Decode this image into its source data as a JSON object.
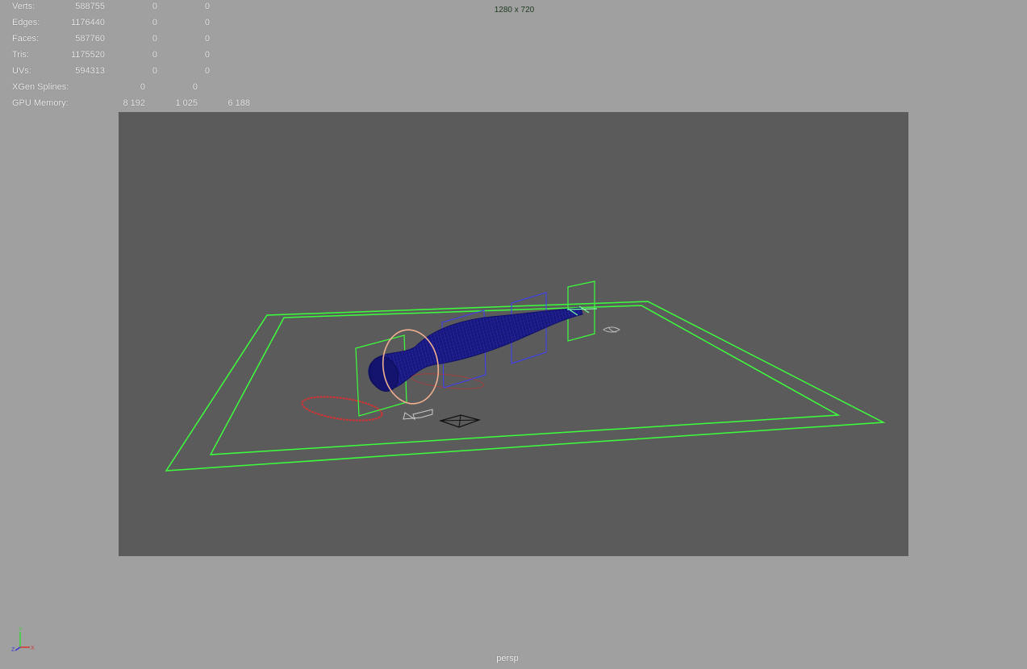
{
  "hud": {
    "verts": {
      "label": "Verts:",
      "values": [
        "588755",
        "0",
        "0"
      ]
    },
    "edges": {
      "label": "Edges:",
      "values": [
        "1176440",
        "0",
        "0"
      ]
    },
    "faces": {
      "label": "Faces:",
      "values": [
        "587760",
        "0",
        "0"
      ]
    },
    "tris": {
      "label": "Tris:",
      "values": [
        "1175520",
        "0",
        "0"
      ]
    },
    "uvs": {
      "label": "UVs:",
      "values": [
        "594313",
        "0",
        "0"
      ]
    },
    "xgen": {
      "label": "XGen Splines:",
      "values": [
        "0",
        "0"
      ]
    },
    "gpu": {
      "label": "GPU Memory:",
      "values": [
        "8 192",
        "1 025",
        "6 188"
      ]
    }
  },
  "viewport": {
    "resolution": "1280 x 720",
    "camera": "persp"
  },
  "colors": {
    "viewport_bg": "#a0a0a0",
    "gate_bg": "#5b5b5b",
    "ground_plane": "#3cff3c",
    "mesh": "#1a1a8c",
    "curve_red": "#cc2a2a",
    "ring": "#f0b090"
  },
  "axis_gizmo": {
    "x": "X",
    "y": "Y",
    "z": "Z"
  }
}
